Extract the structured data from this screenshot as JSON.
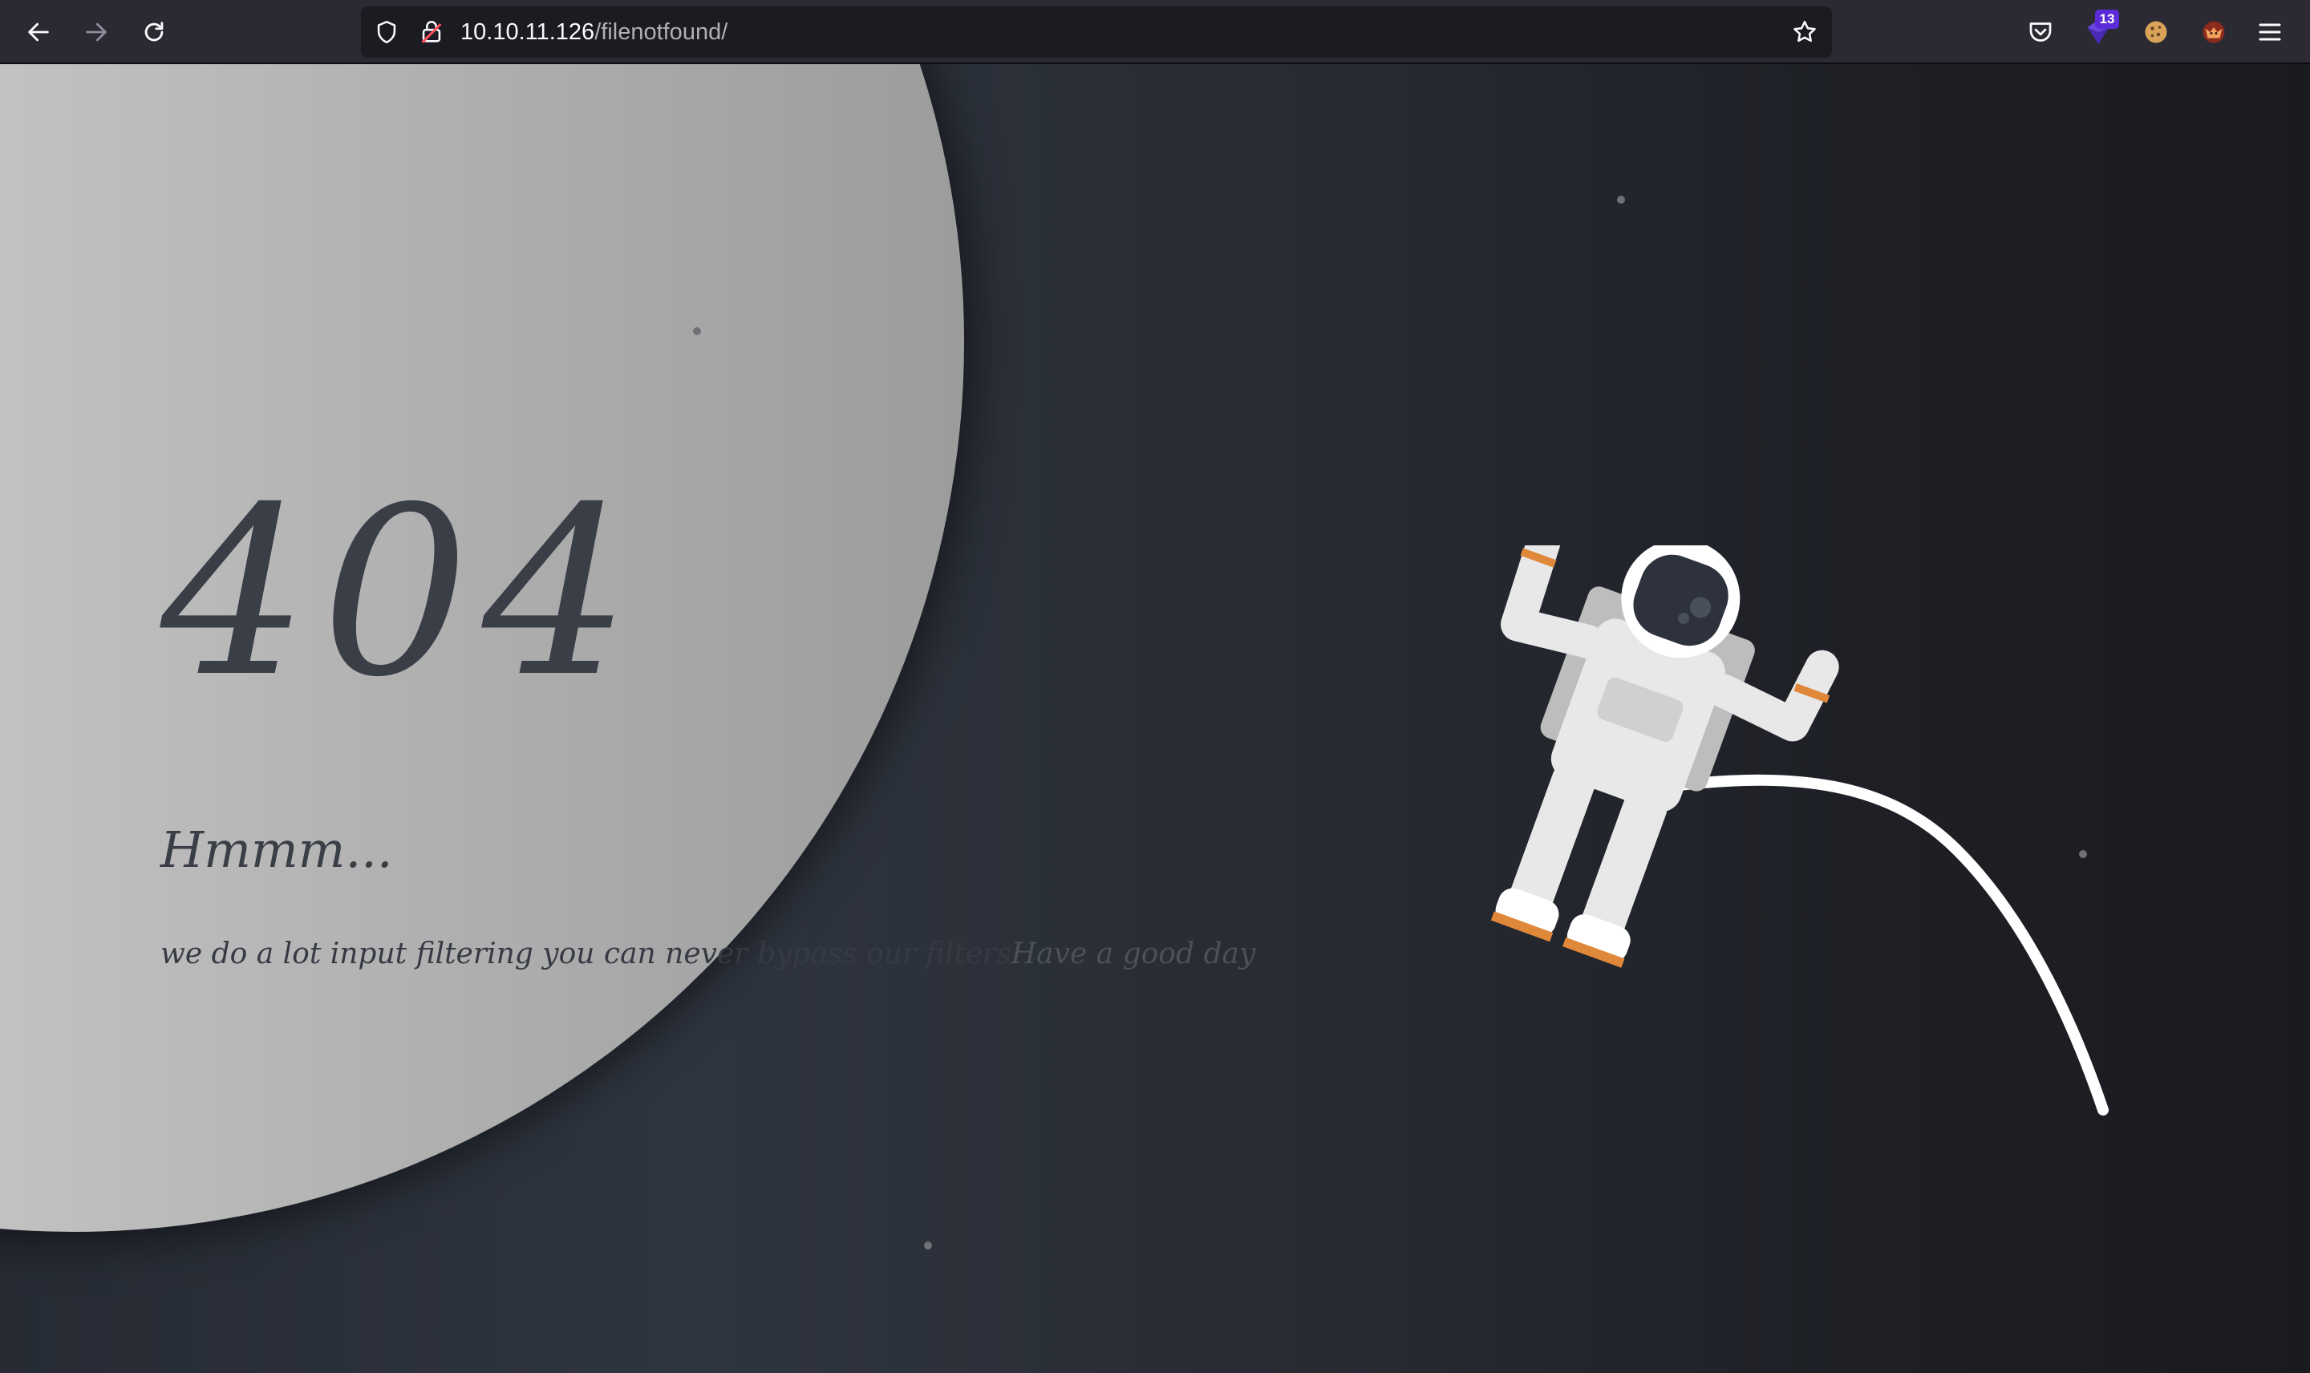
{
  "browser": {
    "url_host": "10.10.11.126",
    "url_path": "/filenotfound/",
    "extension_badge": "13",
    "icons": {
      "back": "arrow-left-icon",
      "forward": "arrow-right-icon",
      "reload": "reload-icon",
      "tracking": "shield-icon",
      "insecure": "insecure-lock-icon",
      "bookmark": "star-icon",
      "pocket": "pocket-icon",
      "extension": "extension-icon",
      "cookie": "cookie-icon",
      "fox": "fox-extension-icon",
      "menu": "hamburger-menu-icon"
    }
  },
  "page": {
    "error_code": "404",
    "heading": "Hmmm...",
    "message": "we do a lot input filtering you can never bypass our filters",
    "message_suffix": "Have a good day"
  },
  "colors": {
    "background": "#1c1e23",
    "moon": "#c4c4c4",
    "text": "#3a3e47",
    "accent": "#e0883a"
  }
}
